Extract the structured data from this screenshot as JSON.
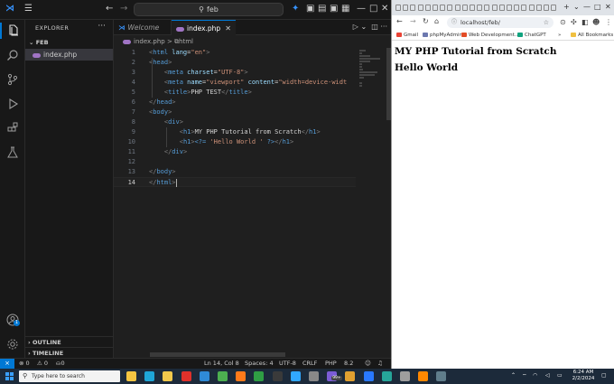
{
  "vscode": {
    "nav_back": "←",
    "nav_forward": "→",
    "search_text": "feb",
    "explorer_title": "EXPLORER",
    "folder_name": "FEB",
    "file_name": "index.php",
    "outline_label": "OUTLINE",
    "timeline_label": "TIMELINE",
    "tabs": {
      "welcome": "Welcome",
      "index": "index.php"
    },
    "breadcrumb": {
      "file": "index.php",
      "sep": ">",
      "node": "html"
    },
    "code_lines": [
      {
        "n": "1",
        "parts": [
          {
            "c": "t-br",
            "t": "<"
          },
          {
            "c": "t-tag",
            "t": "html"
          },
          {
            "c": "t-attr",
            "t": " lang"
          },
          {
            "c": "t-txt",
            "t": "="
          },
          {
            "c": "t-str",
            "t": "\"en\""
          },
          {
            "c": "t-br",
            "t": ">"
          }
        ]
      },
      {
        "n": "2",
        "parts": [
          {
            "c": "t-br",
            "t": "<"
          },
          {
            "c": "t-tag",
            "t": "head"
          },
          {
            "c": "t-br",
            "t": ">"
          }
        ]
      },
      {
        "n": "3",
        "parts": [
          {
            "c": "t-txt",
            "t": "    "
          },
          {
            "c": "t-br",
            "t": "<"
          },
          {
            "c": "t-tag",
            "t": "meta"
          },
          {
            "c": "t-attr",
            "t": " charset"
          },
          {
            "c": "t-txt",
            "t": "="
          },
          {
            "c": "t-str",
            "t": "\"UTF-8\""
          },
          {
            "c": "t-br",
            "t": ">"
          }
        ]
      },
      {
        "n": "4",
        "parts": [
          {
            "c": "t-txt",
            "t": "    "
          },
          {
            "c": "t-br",
            "t": "<"
          },
          {
            "c": "t-tag",
            "t": "meta"
          },
          {
            "c": "t-attr",
            "t": " name"
          },
          {
            "c": "t-txt",
            "t": "="
          },
          {
            "c": "t-str",
            "t": "\"viewport\""
          },
          {
            "c": "t-attr",
            "t": " content"
          },
          {
            "c": "t-txt",
            "t": "="
          },
          {
            "c": "t-str",
            "t": "\"width=device-widt"
          }
        ]
      },
      {
        "n": "5",
        "parts": [
          {
            "c": "t-txt",
            "t": "    "
          },
          {
            "c": "t-br",
            "t": "<"
          },
          {
            "c": "t-tag",
            "t": "title"
          },
          {
            "c": "t-br",
            "t": ">"
          },
          {
            "c": "t-txt",
            "t": "PHP TEST"
          },
          {
            "c": "t-br",
            "t": "</"
          },
          {
            "c": "t-tag",
            "t": "title"
          },
          {
            "c": "t-br",
            "t": ">"
          }
        ]
      },
      {
        "n": "6",
        "parts": [
          {
            "c": "t-br",
            "t": "</"
          },
          {
            "c": "t-tag",
            "t": "head"
          },
          {
            "c": "t-br",
            "t": ">"
          }
        ]
      },
      {
        "n": "7",
        "parts": [
          {
            "c": "t-br",
            "t": "<"
          },
          {
            "c": "t-tag",
            "t": "body"
          },
          {
            "c": "t-br",
            "t": ">"
          }
        ]
      },
      {
        "n": "8",
        "parts": [
          {
            "c": "t-txt",
            "t": "    "
          },
          {
            "c": "t-br",
            "t": "<"
          },
          {
            "c": "t-tag",
            "t": "div"
          },
          {
            "c": "t-br",
            "t": ">"
          }
        ]
      },
      {
        "n": "9",
        "parts": [
          {
            "c": "t-txt",
            "t": "        "
          },
          {
            "c": "t-br",
            "t": "<"
          },
          {
            "c": "t-tag",
            "t": "h1"
          },
          {
            "c": "t-br",
            "t": ">"
          },
          {
            "c": "t-txt",
            "t": "MY PHP Tutorial from Scratch"
          },
          {
            "c": "t-br",
            "t": "</"
          },
          {
            "c": "t-tag",
            "t": "h1"
          },
          {
            "c": "t-br",
            "t": ">"
          }
        ]
      },
      {
        "n": "10",
        "parts": [
          {
            "c": "t-txt",
            "t": "        "
          },
          {
            "c": "t-br",
            "t": "<"
          },
          {
            "c": "t-tag",
            "t": "h1"
          },
          {
            "c": "t-br",
            "t": ">"
          },
          {
            "c": "t-php",
            "t": "<?="
          },
          {
            "c": "t-str",
            "t": " 'Hello World ' "
          },
          {
            "c": "t-php",
            "t": "?>"
          },
          {
            "c": "t-br",
            "t": "</"
          },
          {
            "c": "t-tag",
            "t": "h1"
          },
          {
            "c": "t-br",
            "t": ">"
          }
        ]
      },
      {
        "n": "11",
        "parts": [
          {
            "c": "t-txt",
            "t": "    "
          },
          {
            "c": "t-br",
            "t": "</"
          },
          {
            "c": "t-tag",
            "t": "div"
          },
          {
            "c": "t-br",
            "t": ">"
          }
        ]
      },
      {
        "n": "12",
        "parts": []
      },
      {
        "n": "13",
        "parts": [
          {
            "c": "t-br",
            "t": "</"
          },
          {
            "c": "t-tag",
            "t": "body"
          },
          {
            "c": "t-br",
            "t": ">"
          }
        ]
      },
      {
        "n": "14",
        "parts": [
          {
            "c": "t-br",
            "t": "</"
          },
          {
            "c": "t-tag",
            "t": "html"
          },
          {
            "c": "t-br",
            "t": ">"
          }
        ]
      }
    ],
    "status": {
      "remote": "⨯",
      "errors": "⊗ 0",
      "warnings": "⚠ 0",
      "ports": "⛀0",
      "position": "Ln 14, Col 8",
      "spaces": "Spaces: 4",
      "encoding": "UTF-8",
      "eol": "CRLF",
      "language": "PHP",
      "version": "8.2",
      "bell": "🔔"
    }
  },
  "browser": {
    "url": "localhost/feb/",
    "bookmarks": [
      {
        "label": "Gmail",
        "color": "#ea4335"
      },
      {
        "label": "phpMyAdmin",
        "color": "#6c78af"
      },
      {
        "label": "Web Development...",
        "color": "#e34c26"
      },
      {
        "label": "ChatGPT",
        "color": "#10a37f"
      }
    ],
    "bookmarks_more": "»",
    "all_bookmarks": "All Bookmarks",
    "heading1": "MY PHP Tutorial from Scratch",
    "heading2": "Hello World"
  },
  "taskbar": {
    "search_placeholder": "Type here to search",
    "time": "6:24 AM",
    "date": "2/2/2024",
    "apps": [
      {
        "name": "copilot",
        "color": "#f4c542"
      },
      {
        "name": "edge",
        "color": "#1fa6d8"
      },
      {
        "name": "file-explorer",
        "color": "#f2c94c"
      },
      {
        "name": "opera",
        "color": "#e0312b"
      },
      {
        "name": "vscode",
        "color": "#2f8ad6"
      },
      {
        "name": "chrome",
        "color": "#4caf50"
      },
      {
        "name": "firefox",
        "color": "#ff7a1a"
      },
      {
        "name": "app-green",
        "color": "#2f9e44"
      },
      {
        "name": "app-dark",
        "color": "#3a3a3a"
      },
      {
        "name": "photoshop",
        "color": "#31a8ff"
      },
      {
        "name": "app-circle",
        "color": "#888888"
      },
      {
        "name": "app-purple",
        "color": "#7b5cd6"
      },
      {
        "name": "app-gold",
        "color": "#e0a030"
      },
      {
        "name": "app-blue",
        "color": "#2979ff"
      },
      {
        "name": "app-teal",
        "color": "#26a69a"
      },
      {
        "name": "settings",
        "color": "#9e9e9e"
      },
      {
        "name": "vlc",
        "color": "#ff8800"
      },
      {
        "name": "app-gray",
        "color": "#607d8b"
      }
    ],
    "badge": "99+"
  }
}
